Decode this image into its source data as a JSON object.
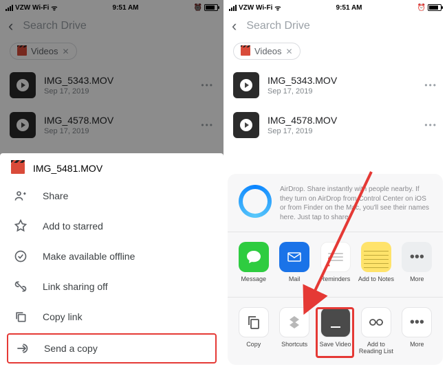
{
  "status": {
    "carrier": "VZW Wi-Fi",
    "time": "9:51 AM"
  },
  "drive": {
    "search_placeholder": "Search Drive",
    "chip_label": "Videos",
    "files": [
      {
        "name": "IMG_5343.MOV",
        "date": "Sep 17, 2019"
      },
      {
        "name": "IMG_4578.MOV",
        "date": "Sep 17, 2019"
      }
    ]
  },
  "sheet": {
    "filename": "IMG_5481.MOV",
    "items": {
      "share": "Share",
      "star": "Add to starred",
      "offline": "Make available offline",
      "linkoff": "Link sharing off",
      "copylink": "Copy link",
      "sendcopy": "Send a copy"
    }
  },
  "ios": {
    "airdrop": "AirDrop. Share instantly with people nearby. If they turn on AirDrop from Control Center on iOS or from Finder on the Mac, you'll see their names here. Just tap to share.",
    "apps": {
      "message": "Message",
      "mail": "Mail",
      "reminders": "Reminders",
      "notes": "Add to Notes",
      "more": "More"
    },
    "actions": {
      "copy": "Copy",
      "shortcuts": "Shortcuts",
      "save": "Save Video",
      "read": "Add to Reading List",
      "more": "More"
    }
  }
}
